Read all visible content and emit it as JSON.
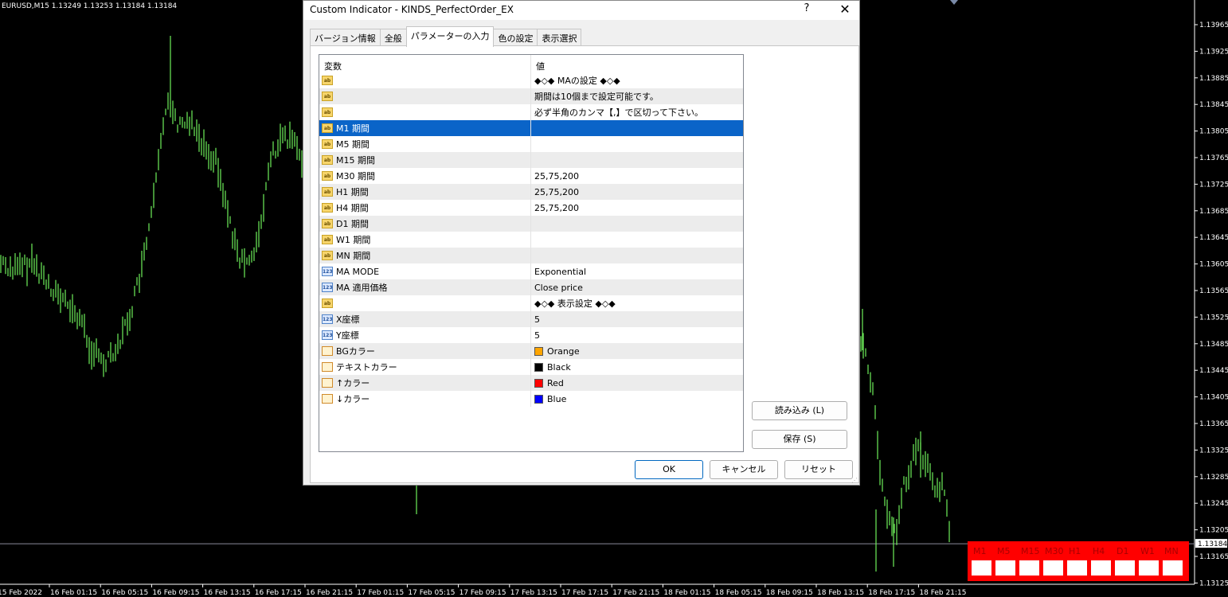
{
  "chart": {
    "symbol_line": "EURUSD,M15  1.13249 1.13253 1.13184 1.13184",
    "price_ticks": [
      "1.13965",
      "1.13925",
      "1.13885",
      "1.13845",
      "1.13805",
      "1.13765",
      "1.13725",
      "1.13685",
      "1.13645",
      "1.13605",
      "1.13565",
      "1.13525",
      "1.13485",
      "1.13445",
      "1.13405",
      "1.13365",
      "1.13325",
      "1.13285",
      "1.13245",
      "1.13205",
      "1.13165",
      "1.13125"
    ],
    "current_price": "1.13184",
    "time_ticks": [
      "15 Feb 2022",
      "16 Feb 01:15",
      "16 Feb 05:15",
      "16 Feb 09:15",
      "16 Feb 13:15",
      "16 Feb 17:15",
      "16 Feb 21:15",
      "17 Feb 01:15",
      "17 Feb 05:15",
      "17 Feb 09:15",
      "17 Feb 13:15",
      "17 Feb 17:15",
      "17 Feb 21:15",
      "18 Feb 01:15",
      "18 Feb 05:15",
      "18 Feb 09:15",
      "18 Feb 13:15",
      "18 Feb 17:15",
      "18 Feb 21:15"
    ],
    "candle_color": "#6ff05a",
    "background": "#000000"
  },
  "dialog": {
    "title": "Custom Indicator - KINDS_PerfectOrder_EX",
    "help": "?",
    "close": "✕",
    "tabs": [
      "バージョン情報",
      "全般",
      "パラメーターの入力",
      "色の設定",
      "表示選択"
    ],
    "active_tab": 2,
    "columns": {
      "variable": "変数",
      "value": "値"
    },
    "rows": [
      {
        "icon": "ab",
        "name": "",
        "value": "◆◇◆ MAの設定 ◆◇◆"
      },
      {
        "icon": "ab",
        "name": "",
        "value": "期間は10個まで設定可能です。"
      },
      {
        "icon": "ab",
        "name": "",
        "value": "必ず半角のカンマ【,】で区切って下さい。"
      },
      {
        "icon": "ab",
        "name": "M1 期間",
        "value": "",
        "selected": true
      },
      {
        "icon": "ab",
        "name": "M5 期間",
        "value": ""
      },
      {
        "icon": "ab",
        "name": "M15 期間",
        "value": ""
      },
      {
        "icon": "ab",
        "name": "M30 期間",
        "value": "25,75,200"
      },
      {
        "icon": "ab",
        "name": "H1 期間",
        "value": "25,75,200"
      },
      {
        "icon": "ab",
        "name": "H4 期間",
        "value": "25,75,200"
      },
      {
        "icon": "ab",
        "name": "D1 期間",
        "value": ""
      },
      {
        "icon": "ab",
        "name": "W1 期間",
        "value": ""
      },
      {
        "icon": "ab",
        "name": "MN 期間",
        "value": ""
      },
      {
        "icon": "num",
        "name": "MA MODE",
        "value": "Exponential"
      },
      {
        "icon": "num",
        "name": "MA 適用価格",
        "value": "Close price"
      },
      {
        "icon": "ab",
        "name": "",
        "value": "◆◇◆ 表示設定 ◆◇◆"
      },
      {
        "icon": "num",
        "name": "X座標",
        "value": "5"
      },
      {
        "icon": "num",
        "name": "Y座標",
        "value": "5"
      },
      {
        "icon": "col",
        "name": "BGカラー",
        "value": "Orange",
        "color": "#ffa500"
      },
      {
        "icon": "col",
        "name": "テキストカラー",
        "value": "Black",
        "color": "#000000"
      },
      {
        "icon": "col",
        "name": "↑カラー",
        "value": "Red",
        "color": "#ff0000"
      },
      {
        "icon": "col",
        "name": "↓カラー",
        "value": "Blue",
        "color": "#0000ff"
      }
    ],
    "buttons": {
      "load": "読み込み (L)",
      "save": "保存 (S)",
      "ok": "OK",
      "cancel": "キャンセル",
      "reset": "リセット"
    }
  },
  "timeframes": [
    "M1",
    "M5",
    "M15",
    "M30",
    "H1",
    "H4",
    "D1",
    "W1",
    "MN"
  ]
}
